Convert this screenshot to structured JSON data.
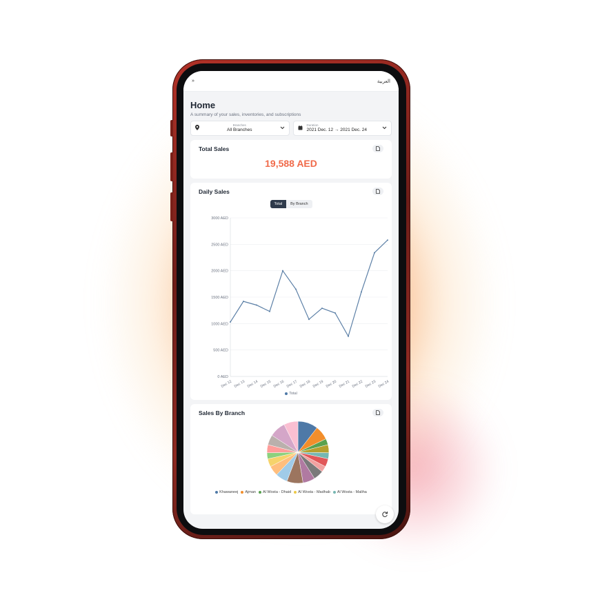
{
  "topbar": {
    "menu_icon": "double-chevron-right-icon",
    "menu_glyph": "»",
    "language": "العربية"
  },
  "page": {
    "title": "Home",
    "subtitle": "A summary of your sales, inventories, and subscriptions"
  },
  "filters": {
    "branches": {
      "label": "Branches",
      "value": "All Branches",
      "icon": "location-pin-icon"
    },
    "duration": {
      "label": "Duration",
      "from": "2021 Dec. 12",
      "arrow": "→",
      "to": "2021 Dec. 24",
      "icon": "calendar-icon"
    }
  },
  "total_sales": {
    "title": "Total Sales",
    "value": "19,588 AED"
  },
  "daily_sales": {
    "title": "Daily Sales",
    "toggle": {
      "total": "Total",
      "by_branch": "By Branch"
    },
    "legend": "Total"
  },
  "sales_by_branch": {
    "title": "Sales By Branch",
    "legend": [
      {
        "name": "Khawaneej",
        "color": "#4e79a7"
      },
      {
        "name": "Ajman",
        "color": "#f28e2b"
      },
      {
        "name": "Al Wosta - Dhaid",
        "color": "#59a14f"
      },
      {
        "name": "Al Wosta - Madhab",
        "color": "#edc948"
      },
      {
        "name": "Al Wosta - Maliha",
        "color": "#76b7b2"
      }
    ]
  },
  "chart_data": [
    {
      "type": "line",
      "title": "Daily Sales",
      "x": [
        "Dec 12",
        "Dec 13",
        "Dec 14",
        "Dec 15",
        "Dec 16",
        "Dec 17",
        "Dec 18",
        "Dec 19",
        "Dec 20",
        "Dec 21",
        "Dec 22",
        "Dec 23",
        "Dec 24"
      ],
      "series": [
        {
          "name": "Total",
          "values": [
            1030,
            1420,
            1350,
            1230,
            2000,
            1650,
            1080,
            1290,
            1200,
            760,
            1600,
            2340,
            2580
          ]
        }
      ],
      "yticks": [
        "0 AED",
        "500 AED",
        "1000 AED",
        "1500 AED",
        "2000 AED",
        "2500 AED",
        "3000 AED"
      ],
      "ylim": [
        0,
        3000
      ],
      "grid": true,
      "legend": "bottom",
      "color": "#5b7fa6"
    },
    {
      "type": "pie",
      "title": "Sales By Branch",
      "values": [
        10,
        7,
        3,
        4,
        3,
        4,
        3,
        5,
        6,
        8,
        6,
        5,
        4,
        3,
        4,
        5,
        8,
        7
      ],
      "colors": [
        "#4e79a7",
        "#f28e2b",
        "#59a14f",
        "#b5a02f",
        "#76b7b2",
        "#e15759",
        "#f1a1a0",
        "#7a7a7a",
        "#b07aa1",
        "#9c755f",
        "#a0cbe8",
        "#ffbe7d",
        "#f6d36b",
        "#8cd17d",
        "#ff9d9a",
        "#bab0ac",
        "#d4a6c8",
        "#fabfd2"
      ],
      "legend": "bottom"
    }
  ]
}
